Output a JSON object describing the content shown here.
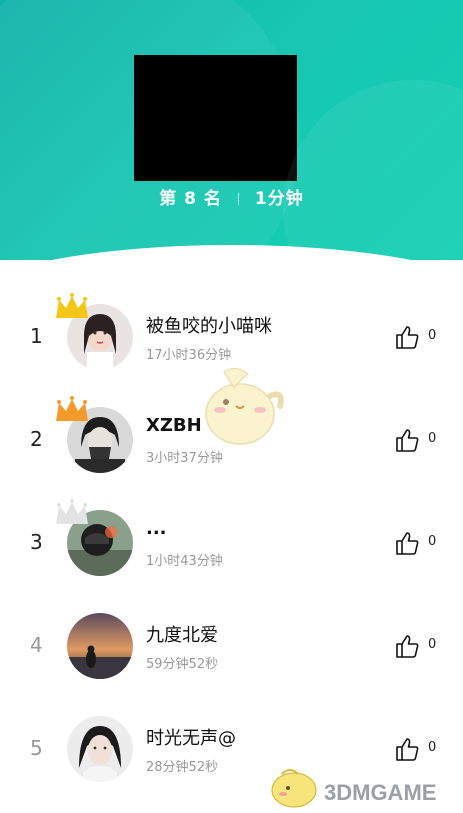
{
  "header": {
    "rank_label": "第 8 名",
    "duration": "1分钟"
  },
  "ranking": [
    {
      "rank": "1",
      "name": "被鱼咬的小喵咪",
      "time": "17小时36分钟",
      "likes": "0",
      "crown": "gold"
    },
    {
      "rank": "2",
      "name": "XZBH",
      "time": "3小时37分钟",
      "likes": "0",
      "crown": "orange"
    },
    {
      "rank": "3",
      "name": "...",
      "time": "1小时43分钟",
      "likes": "0",
      "crown": "silver"
    },
    {
      "rank": "4",
      "name": "九度北爱",
      "time": "59分钟52秒",
      "likes": "0",
      "crown": ""
    },
    {
      "rank": "5",
      "name": "时光无声@",
      "time": "28分钟52秒",
      "likes": "0",
      "crown": ""
    }
  ],
  "watermark": {
    "text": "3DMGAME"
  },
  "colors": {
    "header_teal": "#12c2b0",
    "rank_grey": "#999999"
  }
}
